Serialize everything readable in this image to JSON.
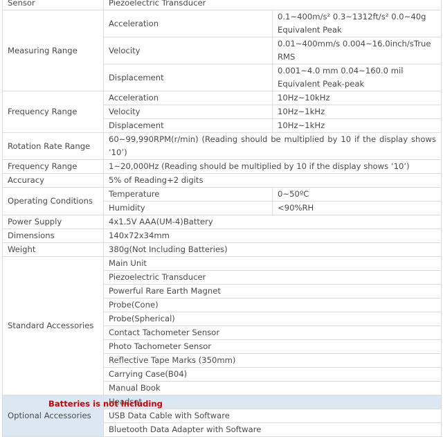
{
  "sensor": {
    "label": "Sensor",
    "value": "Piezoelectric Transducer"
  },
  "measuring_range": {
    "label": "Measuring Range",
    "rows": [
      {
        "name": "Acceleration",
        "value": "0.1~400m/s² 0.3~1312ft/s² 0.0~40g Equivalent Peak"
      },
      {
        "name": "Velocity",
        "value": "0.01~400mm/s 0.004~16.0inch/sTrue RMS"
      },
      {
        "name": "Displacement",
        "value": "0.001~4.0 mm 0.04~160.0 mil Equivalent Peak-peak"
      }
    ]
  },
  "frequency_range": {
    "label": "Frequency Range",
    "rows": [
      {
        "name": "Acceleration",
        "value": "10Hz~10kHz"
      },
      {
        "name": "Velocity",
        "value": "10Hz~1kHz"
      },
      {
        "name": "Displacement",
        "value": "10Hz~1kHz"
      }
    ]
  },
  "rotation_rate_range": {
    "label": "Rotation Rate Range",
    "value": "60~99,990RPM(r/min) (Reading should be multiplied by 10 if the display shows ‘10’)"
  },
  "frequency_range_2": {
    "label": "Frequency Range",
    "value": "1~20,000Hz (Reading should be multiplied by 10 if the display shows ‘10’)"
  },
  "accuracy": {
    "label": "Accuracy",
    "value": "5% of Reading+2 digits"
  },
  "operating_conditions": {
    "label": "Operating Conditions",
    "rows": [
      {
        "name": "Temperature",
        "value": "0~50ºC"
      },
      {
        "name": "Humidity",
        "value": "<90%RH"
      }
    ]
  },
  "power_supply": {
    "label": "Power Supply",
    "value": "4x1.5V AAA(UM-4)Battery"
  },
  "dimensions": {
    "label": "Dimensions",
    "value": "140x72x34mm"
  },
  "weight": {
    "label": "Weight",
    "value": "380g(Not Including Batteries)"
  },
  "standard_accessories": {
    "label": "Standard Accessories",
    "items": [
      "Main Unit",
      "Piezoelectric Transducer",
      "Powerful Rare Earth Magnet",
      "Probe(Cone)",
      "Probe(Spherical)",
      "Contact Tachometer Sensor",
      "Photo Tachometer Sensor",
      "Reflective Tape Marks (350mm)",
      "Carrying Case(B04)",
      "Manual Book"
    ]
  },
  "optional_accessories": {
    "label": "Optional Accessories",
    "items": [
      "Headset",
      "USB Data Cable with Software",
      "Bluetooth Data Adapter with Software"
    ]
  },
  "note": "Batteries is not including",
  "colors": {
    "note": "#cc0000",
    "optional_row_bg": "#dbe8f4",
    "border": "#dcdcdc",
    "text": "#4a4a4a"
  }
}
